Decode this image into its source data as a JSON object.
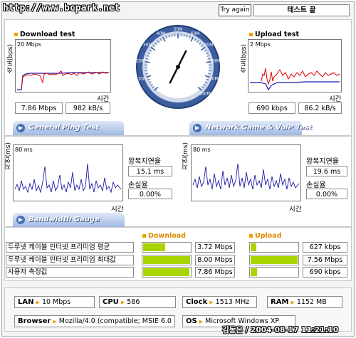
{
  "watermark": "http://www.bcpark.net",
  "header": {
    "try_again": "Try again",
    "status": "테스트 끝"
  },
  "download": {
    "title": "Download test",
    "yaxis": "속도(bps)",
    "scale": "20 Mbps",
    "xaxis": "시간",
    "mbps": "7.86 Mbps",
    "kbs": "982 kB/s"
  },
  "upload": {
    "title": "Upload test",
    "yaxis": "속도(bps)",
    "scale": "2 Mbps",
    "xaxis": "시간",
    "kbps": "690 kbps",
    "kbs": "86.2 kB/s"
  },
  "gauge": {
    "ticks": [
      "10M",
      "20M",
      "30M",
      "40M",
      "50M",
      "60M",
      "70M",
      "80M",
      "90M",
      "100M"
    ],
    "needle_value": 7.86
  },
  "tabs": {
    "ping": "General Ping Test",
    "game": "Network Game & VoIP Test",
    "bandwidth": "Bandwidth Gauge"
  },
  "ping_left": {
    "yaxis": "지연(ms)",
    "scale": "80 ms",
    "xaxis": "시간",
    "latency_label": "왕복지연율",
    "latency": "15.1 ms",
    "loss_label": "손실율",
    "loss": "0.00%"
  },
  "ping_right": {
    "yaxis": "지연(ms)",
    "scale": "80 ms",
    "xaxis": "시간",
    "latency_label": "왕복지연율",
    "latency": "19.6 ms",
    "loss_label": "손실율",
    "loss": "0.00%"
  },
  "bandwidth": {
    "download_header": "Download",
    "upload_header": "Upload",
    "rows": [
      {
        "label": "두루넷 케이블 인터넷 프리미엄 평균",
        "download": "3.72 Mbps",
        "download_level": 0.47,
        "upload": "627 kbps",
        "upload_level": 0.12
      },
      {
        "label": "두루넷 케이블 인터넷 프리미엄 최대값",
        "download": "8.00 Mbps",
        "download_level": 1.0,
        "upload": "7.56 Mbps",
        "upload_level": 1.0
      },
      {
        "label": "사용자 측정값",
        "download": "7.86 Mbps",
        "download_level": 0.98,
        "upload": "690 kbps",
        "upload_level": 0.13
      }
    ]
  },
  "system": {
    "lan_label": "LAN",
    "lan": "10 Mbps",
    "cpu_label": "CPU",
    "cpu": "586",
    "clock_label": "Clock",
    "clock": "1513 MHz",
    "ram_label": "RAM",
    "ram": "1152 MB",
    "browser_label": "Browser",
    "browser": "Mozilla/4.0 (compatible; MSIE 6.0",
    "os_label": "OS",
    "os": "Microsoft Windows XP"
  },
  "signature": "김동은 / 2004-08-17 11:21:10",
  "colors": {
    "download_line": "#e00000",
    "baseline": "#1a1aa8",
    "bar": "#a8d400",
    "accent": "#f0a000",
    "tab": "#9fb8e4"
  }
}
